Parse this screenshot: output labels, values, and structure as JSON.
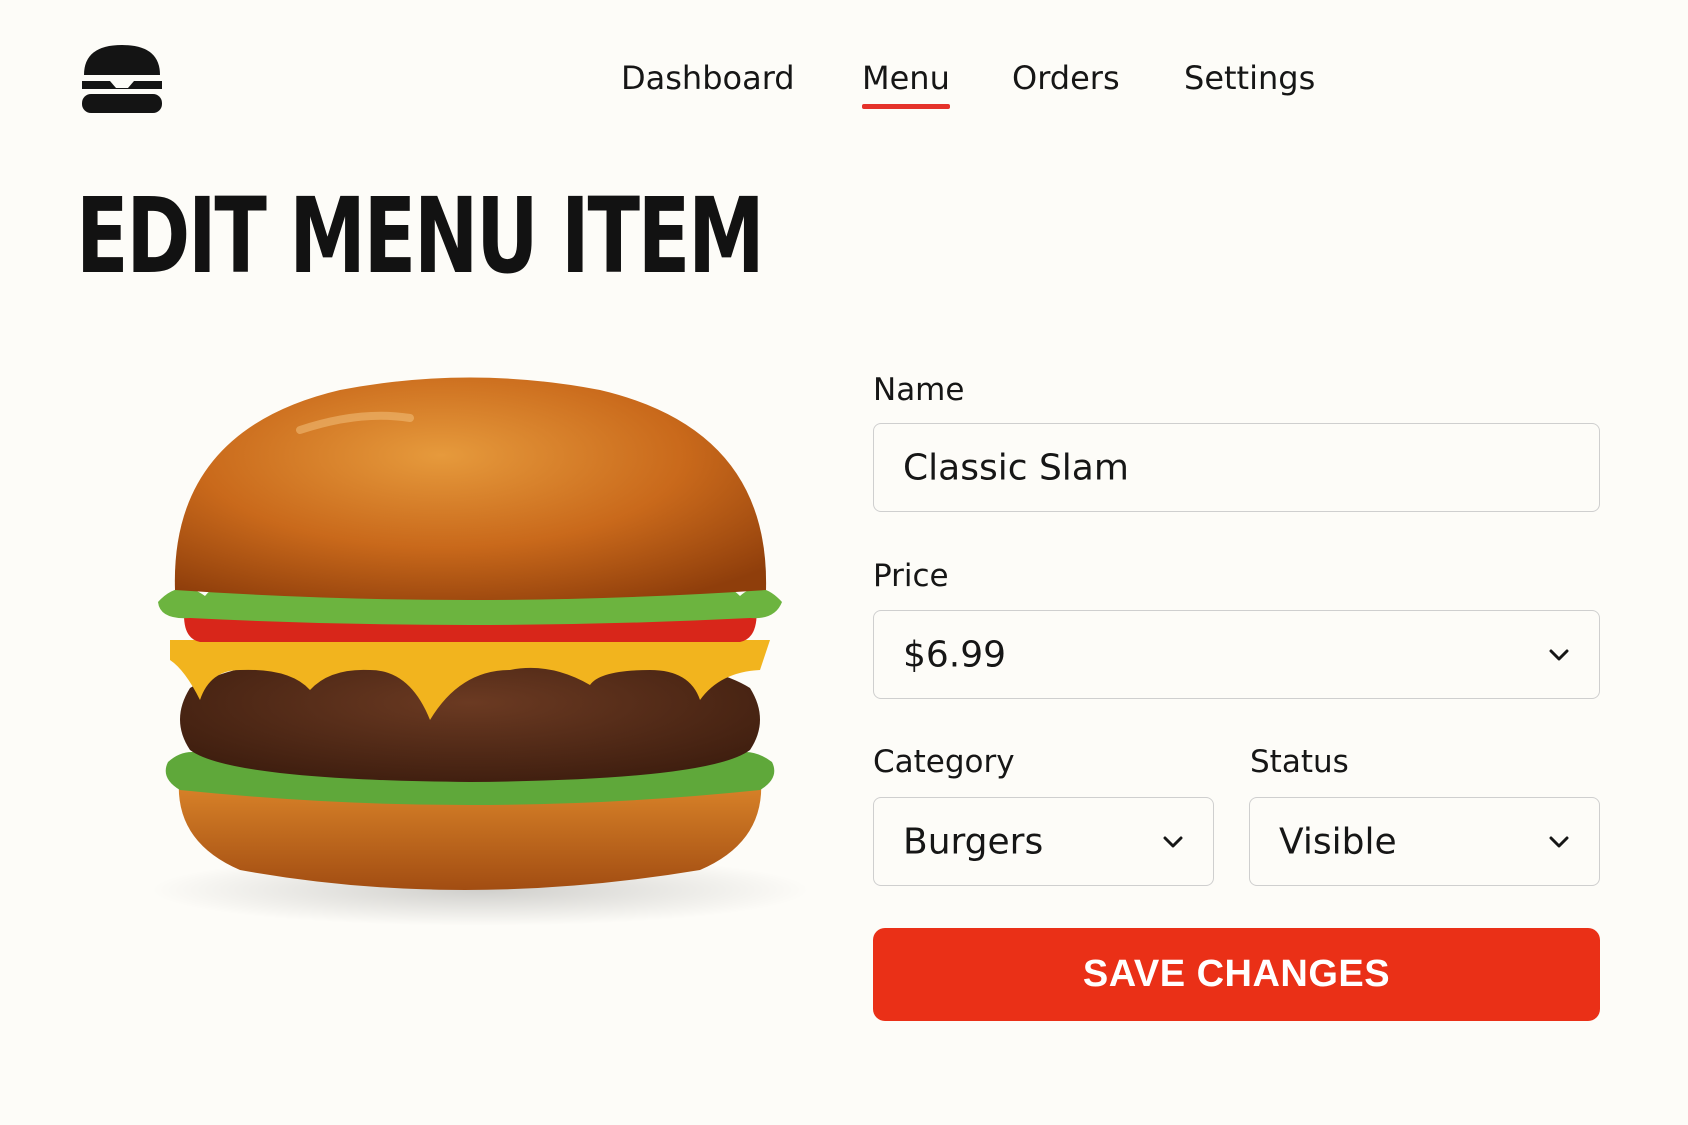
{
  "app": {
    "logo_icon": "burger-icon"
  },
  "nav": {
    "items": [
      {
        "label": "Dashboard"
      },
      {
        "label": "Menu"
      },
      {
        "label": "Orders"
      },
      {
        "label": "Settings"
      }
    ],
    "active": "Menu"
  },
  "page": {
    "title": "EDIT MENU ITEM"
  },
  "item_image": {
    "subject": "cheeseburger"
  },
  "form": {
    "name": {
      "label": "Name",
      "value": "Classic Slam"
    },
    "price": {
      "label": "Price",
      "value": "$6.99"
    },
    "category": {
      "label": "Category",
      "value": "Burgers"
    },
    "status": {
      "label": "Status",
      "value": "Visible"
    },
    "save_label": "SAVE CHANGES"
  },
  "colors": {
    "accent": "#e5322a",
    "button": "#ea3017",
    "background": "#fdfcf8",
    "text": "#141414"
  }
}
